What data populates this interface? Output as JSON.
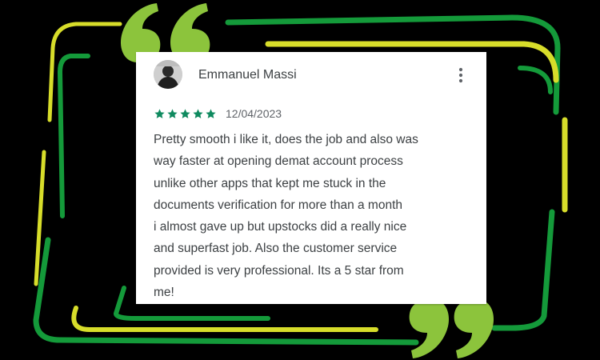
{
  "colors": {
    "frame_dark_green": "#149a3a",
    "frame_lime": "#d7dd2a",
    "quote_green": "#8cc43c",
    "star_green": "#0f8a5f",
    "card_bg": "#ffffff",
    "text": "#3c4043"
  },
  "review": {
    "reviewer_name": "Emmanuel Massi",
    "rating": 5,
    "rating_max": 5,
    "date": "12/04/2023",
    "lines": [
      "Pretty smooth i like it, does the job and also was",
      "way faster at opening demat account process",
      "unlike other apps that kept me stuck in the",
      "documents verification for more than a month",
      "i almost gave up but upstocks did a really nice",
      "and superfast job. Also the customer service",
      "provided is very professional. Its a 5 star from",
      "me!"
    ]
  },
  "icons": {
    "avatar": "reviewer-avatar-photo",
    "more": "more-vert-icon",
    "star": "star-icon",
    "open_quote": "open-quote-icon",
    "close_quote": "close-quote-icon"
  }
}
